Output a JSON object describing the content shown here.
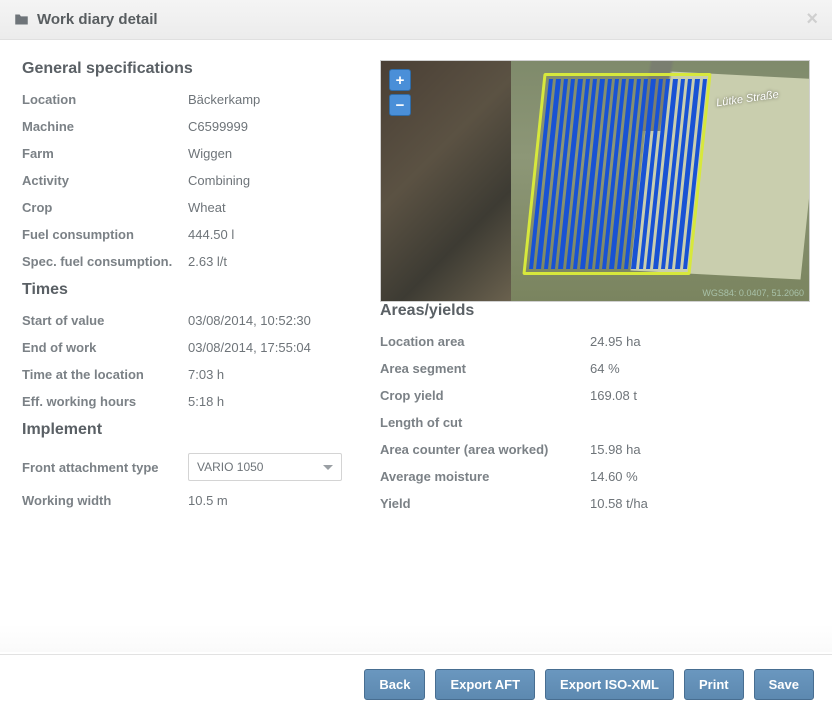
{
  "header": {
    "title": "Work diary detail"
  },
  "general": {
    "title": "General specifications",
    "location_label": "Location",
    "location_value": "Bäckerkamp",
    "machine_label": "Machine",
    "machine_value": "C6599999",
    "farm_label": "Farm",
    "farm_value": "Wiggen",
    "activity_label": "Activity",
    "activity_value": "Combining",
    "crop_label": "Crop",
    "crop_value": "Wheat",
    "fuel_label": "Fuel consumption",
    "fuel_value": "444.50 l",
    "specfuel_label": "Spec. fuel consumption.",
    "specfuel_value": "2.63 l/t"
  },
  "times": {
    "title": "Times",
    "start_label": "Start of value",
    "start_value": "03/08/2014, 10:52:30",
    "end_label": "End of work",
    "end_value": "03/08/2014, 17:55:04",
    "timeat_label": "Time at the location",
    "timeat_value": "7:03 h",
    "effhours_label": "Eff. working hours",
    "effhours_value": "5:18 h"
  },
  "implement": {
    "title": "Implement",
    "front_label": "Front attachment type",
    "front_value": "VARIO 1050",
    "width_label": "Working width",
    "width_value": "10.5 m"
  },
  "areas": {
    "title": "Areas/yields",
    "locarea_label": "Location area",
    "locarea_value": "24.95 ha",
    "seg_label": "Area segment",
    "seg_value": "64 %",
    "cropyield_label": "Crop yield",
    "cropyield_value": "169.08 t",
    "cut_label": "Length of cut",
    "cut_value": "",
    "counter_label": "Area counter (area worked)",
    "counter_value": "15.98 ha",
    "moisture_label": "Average moisture",
    "moisture_value": "14.60 %",
    "yield_label": "Yield",
    "yield_value": "10.58 t/ha"
  },
  "map": {
    "street": "Lütke Straße",
    "coord": "WGS84: 0.0407, 51.2060",
    "zoom_in": "+",
    "zoom_out": "−"
  },
  "footer": {
    "back": "Back",
    "export_aft": "Export AFT",
    "export_iso": "Export ISO-XML",
    "print": "Print",
    "save": "Save"
  }
}
